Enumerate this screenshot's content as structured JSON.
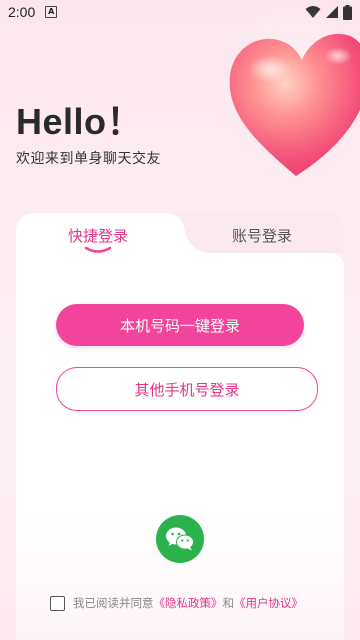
{
  "status_bar": {
    "time": "2:00",
    "notification_icon": "A"
  },
  "header": {
    "greeting": "Hello！",
    "subtitle": "欢迎来到单身聊天交友"
  },
  "tabs": [
    {
      "label": "快捷登录",
      "active": true
    },
    {
      "label": "账号登录",
      "active": false
    }
  ],
  "buttons": {
    "one_click_login": "本机号码一键登录",
    "other_phone_login": "其他手机号登录"
  },
  "wechat": {
    "icon": "wechat-icon"
  },
  "agreement": {
    "checked": false,
    "prefix": "我已阅读并同意",
    "privacy": "《隐私政策》",
    "and": "和",
    "terms": "《用户协议》"
  },
  "colors": {
    "accent": "#f2449a",
    "wechat_green": "#2bb24c",
    "background": "#fbe6ee"
  }
}
